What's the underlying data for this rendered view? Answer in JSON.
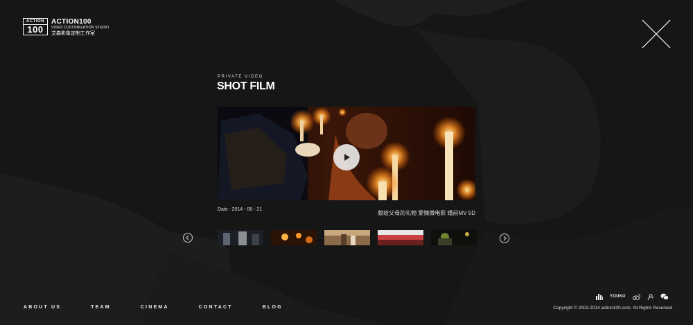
{
  "logo": {
    "mark_top": "ACTION",
    "mark_bottom": "100",
    "name": "ACTION100",
    "subtitle": "VIDEO CUSTOMIZATION STUDIO",
    "chinese": "艾森影象定制工作室"
  },
  "section": {
    "eyebrow": "PRIVATE VIDEO",
    "title": "SHOT FILM"
  },
  "video": {
    "date": "Date : 2014 - 06 - 21",
    "caption": "献给父母的礼物 爱情微电影 婚前MV 5D"
  },
  "nav": [
    {
      "label": "ABOUT US"
    },
    {
      "label": "TEAM"
    },
    {
      "label": "CINEMA"
    },
    {
      "label": "CONTACT"
    },
    {
      "label": "BLOG"
    }
  ],
  "social": {
    "youku_label": "YOUKU"
  },
  "footer": {
    "copyright": "Copyright © 2003-2014 action100.com. All Rights Reserved"
  },
  "colors": {
    "background": "#161616",
    "text": "#ffffff",
    "candle": "#ffb347"
  }
}
